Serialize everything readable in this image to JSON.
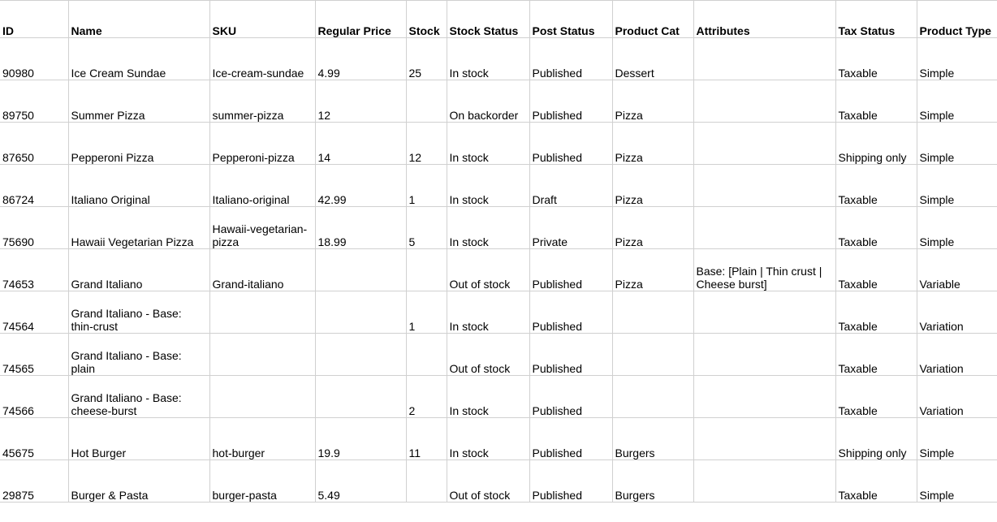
{
  "table": {
    "headers": {
      "id": "ID",
      "name": "Name",
      "sku": "SKU",
      "price": "Regular Price",
      "stock": "Stock",
      "stock_status": "Stock Status",
      "post_status": "Post Status",
      "product_cat": "Product Cat",
      "attributes": "Attributes",
      "tax_status": "Tax Status",
      "product_type": "Product Type"
    },
    "rows": [
      {
        "id": "90980",
        "name": "Ice Cream Sundae",
        "sku": "Ice-cream-sundae",
        "price": "4.99",
        "stock": "25",
        "stock_status": "In stock",
        "post_status": "Published",
        "product_cat": "Dessert",
        "attributes": "",
        "tax_status": "Taxable",
        "product_type": "Simple"
      },
      {
        "id": "89750",
        "name": "Summer Pizza",
        "sku": "summer-pizza",
        "price": "12",
        "stock": "",
        "stock_status": "On backorder",
        "post_status": "Published",
        "product_cat": "Pizza",
        "attributes": "",
        "tax_status": "Taxable",
        "product_type": "Simple"
      },
      {
        "id": "87650",
        "name": "Pepperoni Pizza",
        "sku": "Pepperoni-pizza",
        "price": "14",
        "stock": "12",
        "stock_status": "In stock",
        "post_status": "Published",
        "product_cat": "Pizza",
        "attributes": "",
        "tax_status": "Shipping only",
        "product_type": "Simple"
      },
      {
        "id": "86724",
        "name": "Italiano Original",
        "sku": "Italiano-original",
        "price": "42.99",
        "stock": "1",
        "stock_status": "In stock",
        "post_status": "Draft",
        "product_cat": "Pizza",
        "attributes": "",
        "tax_status": "Taxable",
        "product_type": "Simple"
      },
      {
        "id": "75690",
        "name": "Hawaii Vegetarian Pizza",
        "sku": "Hawaii-vegetarian-pizza",
        "price": "18.99",
        "stock": "5",
        "stock_status": "In stock",
        "post_status": "Private",
        "product_cat": "Pizza",
        "attributes": "",
        "tax_status": "Taxable",
        "product_type": "Simple"
      },
      {
        "id": "74653",
        "name": "Grand Italiano",
        "sku": "Grand-italiano",
        "price": "",
        "stock": "",
        "stock_status": "Out of stock",
        "post_status": "Published",
        "product_cat": "Pizza",
        "attributes": "Base: [Plain | Thin crust | Cheese burst]",
        "tax_status": "Taxable",
        "product_type": "Variable"
      },
      {
        "id": "74564",
        "name": "Grand Italiano - Base: thin-crust",
        "sku": "",
        "price": "",
        "stock": "1",
        "stock_status": "In stock",
        "post_status": "Published",
        "product_cat": "",
        "attributes": "",
        "tax_status": "Taxable",
        "product_type": "Variation"
      },
      {
        "id": "74565",
        "name": "Grand Italiano - Base: plain",
        "sku": "",
        "price": "",
        "stock": "",
        "stock_status": "Out of stock",
        "post_status": "Published",
        "product_cat": "",
        "attributes": "",
        "tax_status": "Taxable",
        "product_type": "Variation"
      },
      {
        "id": "74566",
        "name": "Grand Italiano - Base: cheese-burst",
        "sku": "",
        "price": "",
        "stock": "2",
        "stock_status": "In stock",
        "post_status": "Published",
        "product_cat": "",
        "attributes": "",
        "tax_status": "Taxable",
        "product_type": "Variation"
      },
      {
        "id": "45675",
        "name": "Hot Burger",
        "sku": "hot-burger",
        "price": "19.9",
        "stock": "11",
        "stock_status": "In stock",
        "post_status": "Published",
        "product_cat": "Burgers",
        "attributes": "",
        "tax_status": "Shipping only",
        "product_type": "Simple"
      },
      {
        "id": "29875",
        "name": "Burger & Pasta",
        "sku": "burger-pasta",
        "price": "5.49",
        "stock": "",
        "stock_status": "Out of stock",
        "post_status": "Published",
        "product_cat": "Burgers",
        "attributes": "",
        "tax_status": "Taxable",
        "product_type": "Simple"
      }
    ]
  }
}
